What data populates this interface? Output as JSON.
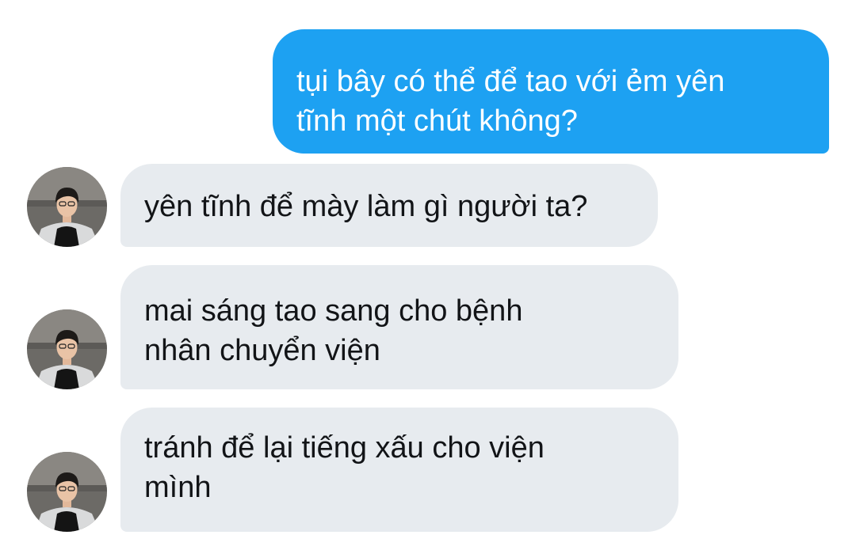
{
  "messages": [
    {
      "sender": "me",
      "text": "tụi bây có thể để tao với ẻm yên\ntĩnh một chút không?"
    },
    {
      "sender": "other",
      "text": "yên tĩnh để mày làm gì người ta?"
    },
    {
      "sender": "other",
      "text": "mai sáng tao sang cho bệnh\nnhân chuyển viện"
    },
    {
      "sender": "other",
      "text": "tránh để lại tiếng xấu cho viện\nmình"
    }
  ],
  "colors": {
    "outgoing_bubble": "#1da1f2",
    "incoming_bubble": "#e7ebef",
    "incoming_text": "#121417",
    "outgoing_text": "#ffffff"
  },
  "icons": {
    "avatar": "user-avatar-photo"
  }
}
